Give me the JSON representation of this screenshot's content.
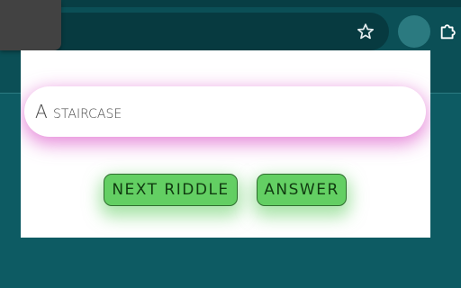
{
  "popup": {
    "answer_text": "A staircase",
    "next_button_label": "NEXT RIDDLE",
    "answer_button_label": "ANSWER"
  },
  "colors": {
    "browser_background": "#0d5b63",
    "answer_glow": "#de64cd",
    "button_fill": "#63cf63"
  },
  "icons": {
    "star": "star-icon",
    "profile": "profile-icon",
    "extensions": "puzzle-icon"
  }
}
